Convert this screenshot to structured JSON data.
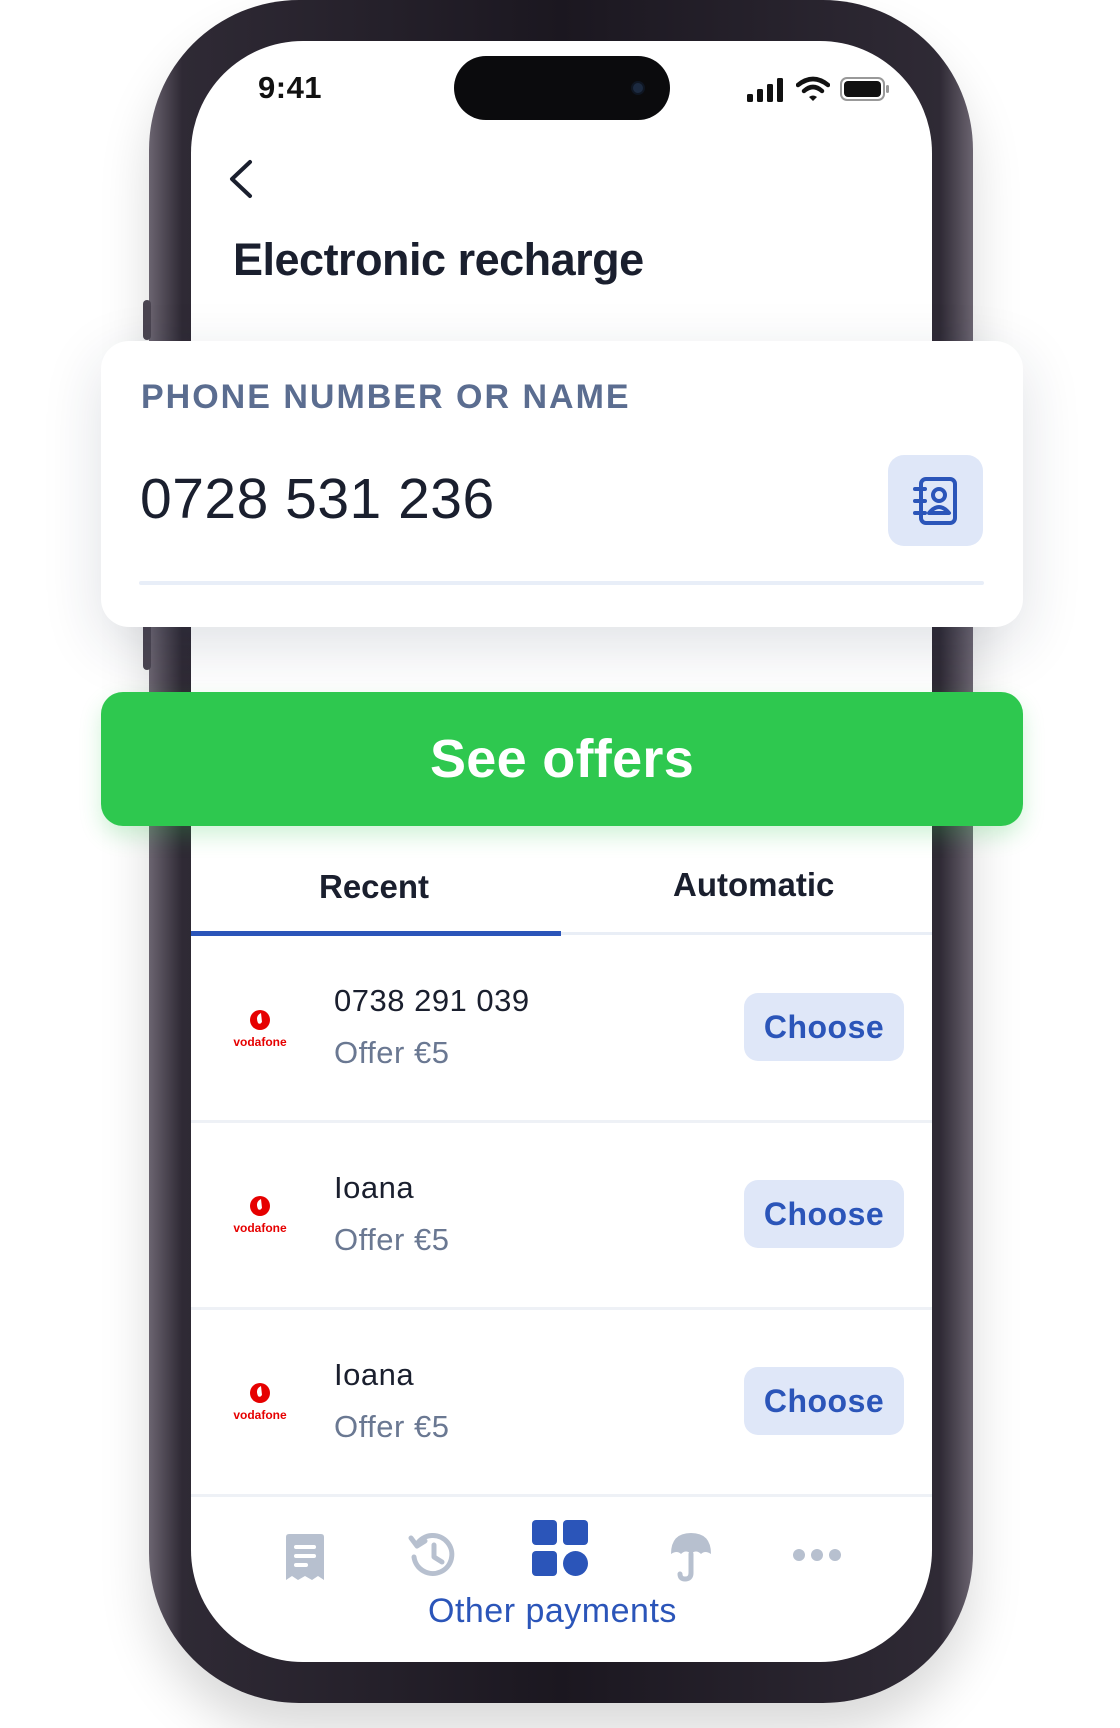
{
  "status_bar": {
    "time": "9:41"
  },
  "header": {
    "title": "Electronic recharge"
  },
  "input": {
    "label": "PHONE NUMBER OR NAME",
    "value": "0728 531 236"
  },
  "cta": {
    "label": "See offers"
  },
  "tabs": [
    {
      "label": "Recent",
      "active": true
    },
    {
      "label": "Automatic",
      "active": false
    }
  ],
  "recent": [
    {
      "operator": "vodafone",
      "title": "0738 291 039",
      "subtitle": "Offer €5",
      "action": "Choose"
    },
    {
      "operator": "vodafone",
      "title": "Ioana",
      "subtitle": "Offer €5",
      "action": "Choose"
    },
    {
      "operator": "vodafone",
      "title": "Ioana",
      "subtitle": "Offer €5",
      "action": "Choose"
    }
  ],
  "bottom_nav": {
    "items": [
      {
        "icon": "receipt-icon"
      },
      {
        "icon": "history-icon"
      },
      {
        "icon": "grid-icon",
        "active": true
      },
      {
        "icon": "umbrella-icon"
      },
      {
        "icon": "more-icon"
      }
    ],
    "active_label": "Other payments"
  },
  "colors": {
    "accent": "#2b55b9",
    "cta_green": "#2ec84f",
    "chip_bg": "#dfe7f8",
    "vodafone_red": "#e60000"
  }
}
